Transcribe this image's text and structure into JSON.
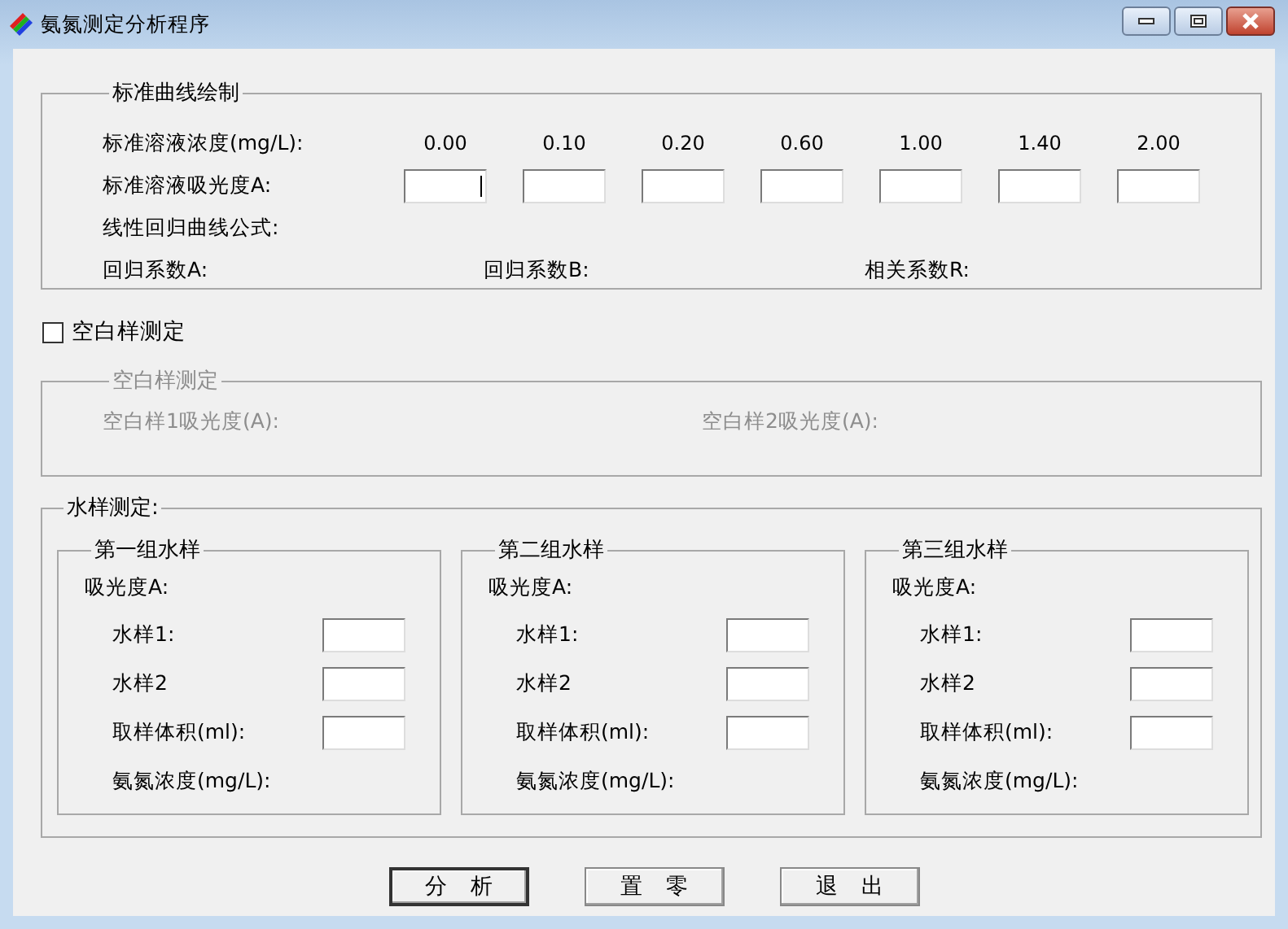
{
  "window": {
    "title": "氨氮测定分析程序"
  },
  "standard_curve": {
    "title": "标准曲线绘制",
    "concentration_label": "标准溶液浓度(mg/L):",
    "concentrations": [
      "0.00",
      "0.10",
      "0.20",
      "0.60",
      "1.00",
      "1.40",
      "2.00"
    ],
    "absorbance_label": "标准溶液吸光度A:",
    "absorbance_inputs": [
      {
        "focused": true
      },
      {
        "focused": false
      },
      {
        "focused": false
      },
      {
        "focused": false
      },
      {
        "focused": false
      },
      {
        "focused": false
      },
      {
        "focused": false
      }
    ],
    "formula_label": "线性回归曲线公式:",
    "coefficients": [
      "回归系数A:",
      "回归系数B:",
      "相关系数R:"
    ]
  },
  "blank_test": {
    "checkbox": {
      "label": "空白样测定",
      "checked": false
    },
    "group_title": "空白样测定",
    "fields": [
      "空白样1吸光度(A):",
      "空白样2吸光度(A):"
    ]
  },
  "water_test": {
    "title": "水样测定:",
    "groups": [
      {
        "title": "第一组水样",
        "absorbance_label": "吸光度A:",
        "inputs": [
          "水样1:",
          "水样2",
          "取样体积(ml):"
        ],
        "result_label": "氨氮浓度(mg/L):"
      },
      {
        "title": "第二组水样",
        "absorbance_label": "吸光度A:",
        "inputs": [
          "水样1:",
          "水样2",
          "取样体积(ml):"
        ],
        "result_label": "氨氮浓度(mg/L):"
      },
      {
        "title": "第三组水样",
        "absorbance_label": "吸光度A:",
        "inputs": [
          "水样1:",
          "水样2",
          "取样体积(ml):"
        ],
        "result_label": "氨氮浓度(mg/L):"
      }
    ]
  },
  "buttons": [
    "分 析",
    "置 零",
    "退 出"
  ]
}
